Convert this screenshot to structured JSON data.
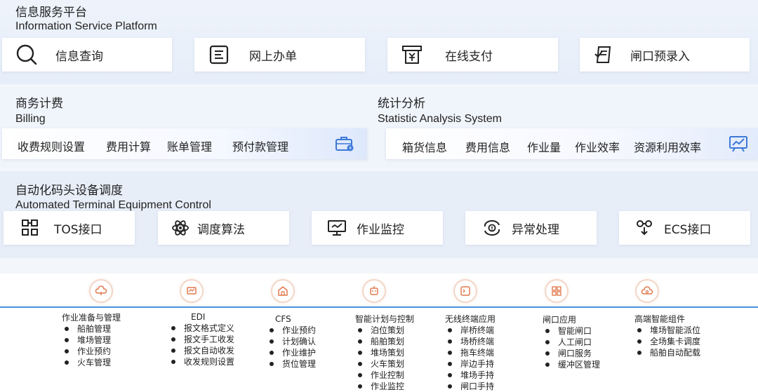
{
  "info": {
    "title_cn": "信息服务平台",
    "title_en": "Information Service Platform",
    "cards": [
      {
        "label": "信息查询",
        "icon": "search-icon"
      },
      {
        "label": "网上办单",
        "icon": "document-icon"
      },
      {
        "label": "在线支付",
        "icon": "payment-icon"
      },
      {
        "label": "闸口预录入",
        "icon": "form-entry-icon"
      }
    ]
  },
  "billing": {
    "title_cn": "商务计费",
    "title_en": "Billing",
    "items": [
      "收费规则设置",
      "费用计算",
      "账单管理",
      "预付款管理"
    ],
    "icon": "briefcase-icon"
  },
  "stats": {
    "title_cn": "统计分析",
    "title_en": "Statistic Analysis System",
    "items": [
      "箱货信息",
      "费用信息",
      "作业量",
      "作业效率",
      "资源利用效率"
    ],
    "icon": "chart-board-icon"
  },
  "equipment": {
    "title_cn": "自动化码头设备调度",
    "title_en": "Automated Terminal Equipment Control",
    "cards": [
      {
        "label": "TOS接口",
        "icon": "grid-blocks-icon"
      },
      {
        "label": "调度算法",
        "icon": "atom-icon"
      },
      {
        "label": "作业监控",
        "icon": "monitor-icon"
      },
      {
        "label": "异常处理",
        "icon": "alert-cycle-icon"
      },
      {
        "label": "ECS接口",
        "icon": "connector-icon"
      }
    ]
  },
  "modules": [
    {
      "title": "作业准备与管理",
      "icon": "cloud-icon",
      "items": [
        "船舶管理",
        "堆场管理",
        "作业预约",
        "火车管理"
      ]
    },
    {
      "title": "EDI",
      "icon": "screen-icon",
      "items": [
        "报文格式定义",
        "报文手工收发",
        "报文自动收发",
        "收发规则设置"
      ]
    },
    {
      "title": "CFS",
      "icon": "warehouse-icon",
      "items": [
        "作业预约",
        "计划确认",
        "作业维护",
        "货位管理"
      ]
    },
    {
      "title": "智能计划与控制",
      "icon": "robot-icon",
      "items": [
        "泊位策划",
        "船舶策划",
        "堆场策划",
        "火车策划",
        "作业控制",
        "作业监控"
      ]
    },
    {
      "title": "无线终端应用",
      "icon": "terminal-icon",
      "items": [
        "岸桥终端",
        "场桥终端",
        "拖车终端",
        "岸边手持",
        "堆场手持",
        "闸口手持"
      ]
    },
    {
      "title": "闸口应用",
      "icon": "gate-grid-icon",
      "items": [
        "智能闸口",
        "人工闸口",
        "闸口服务",
        "缓冲区管理"
      ]
    },
    {
      "title": "高端智能组件",
      "icon": "cloud-gear-icon",
      "items": [
        "堆场智能派位",
        "全场集卡调度",
        "船舶自动配载"
      ]
    }
  ]
}
